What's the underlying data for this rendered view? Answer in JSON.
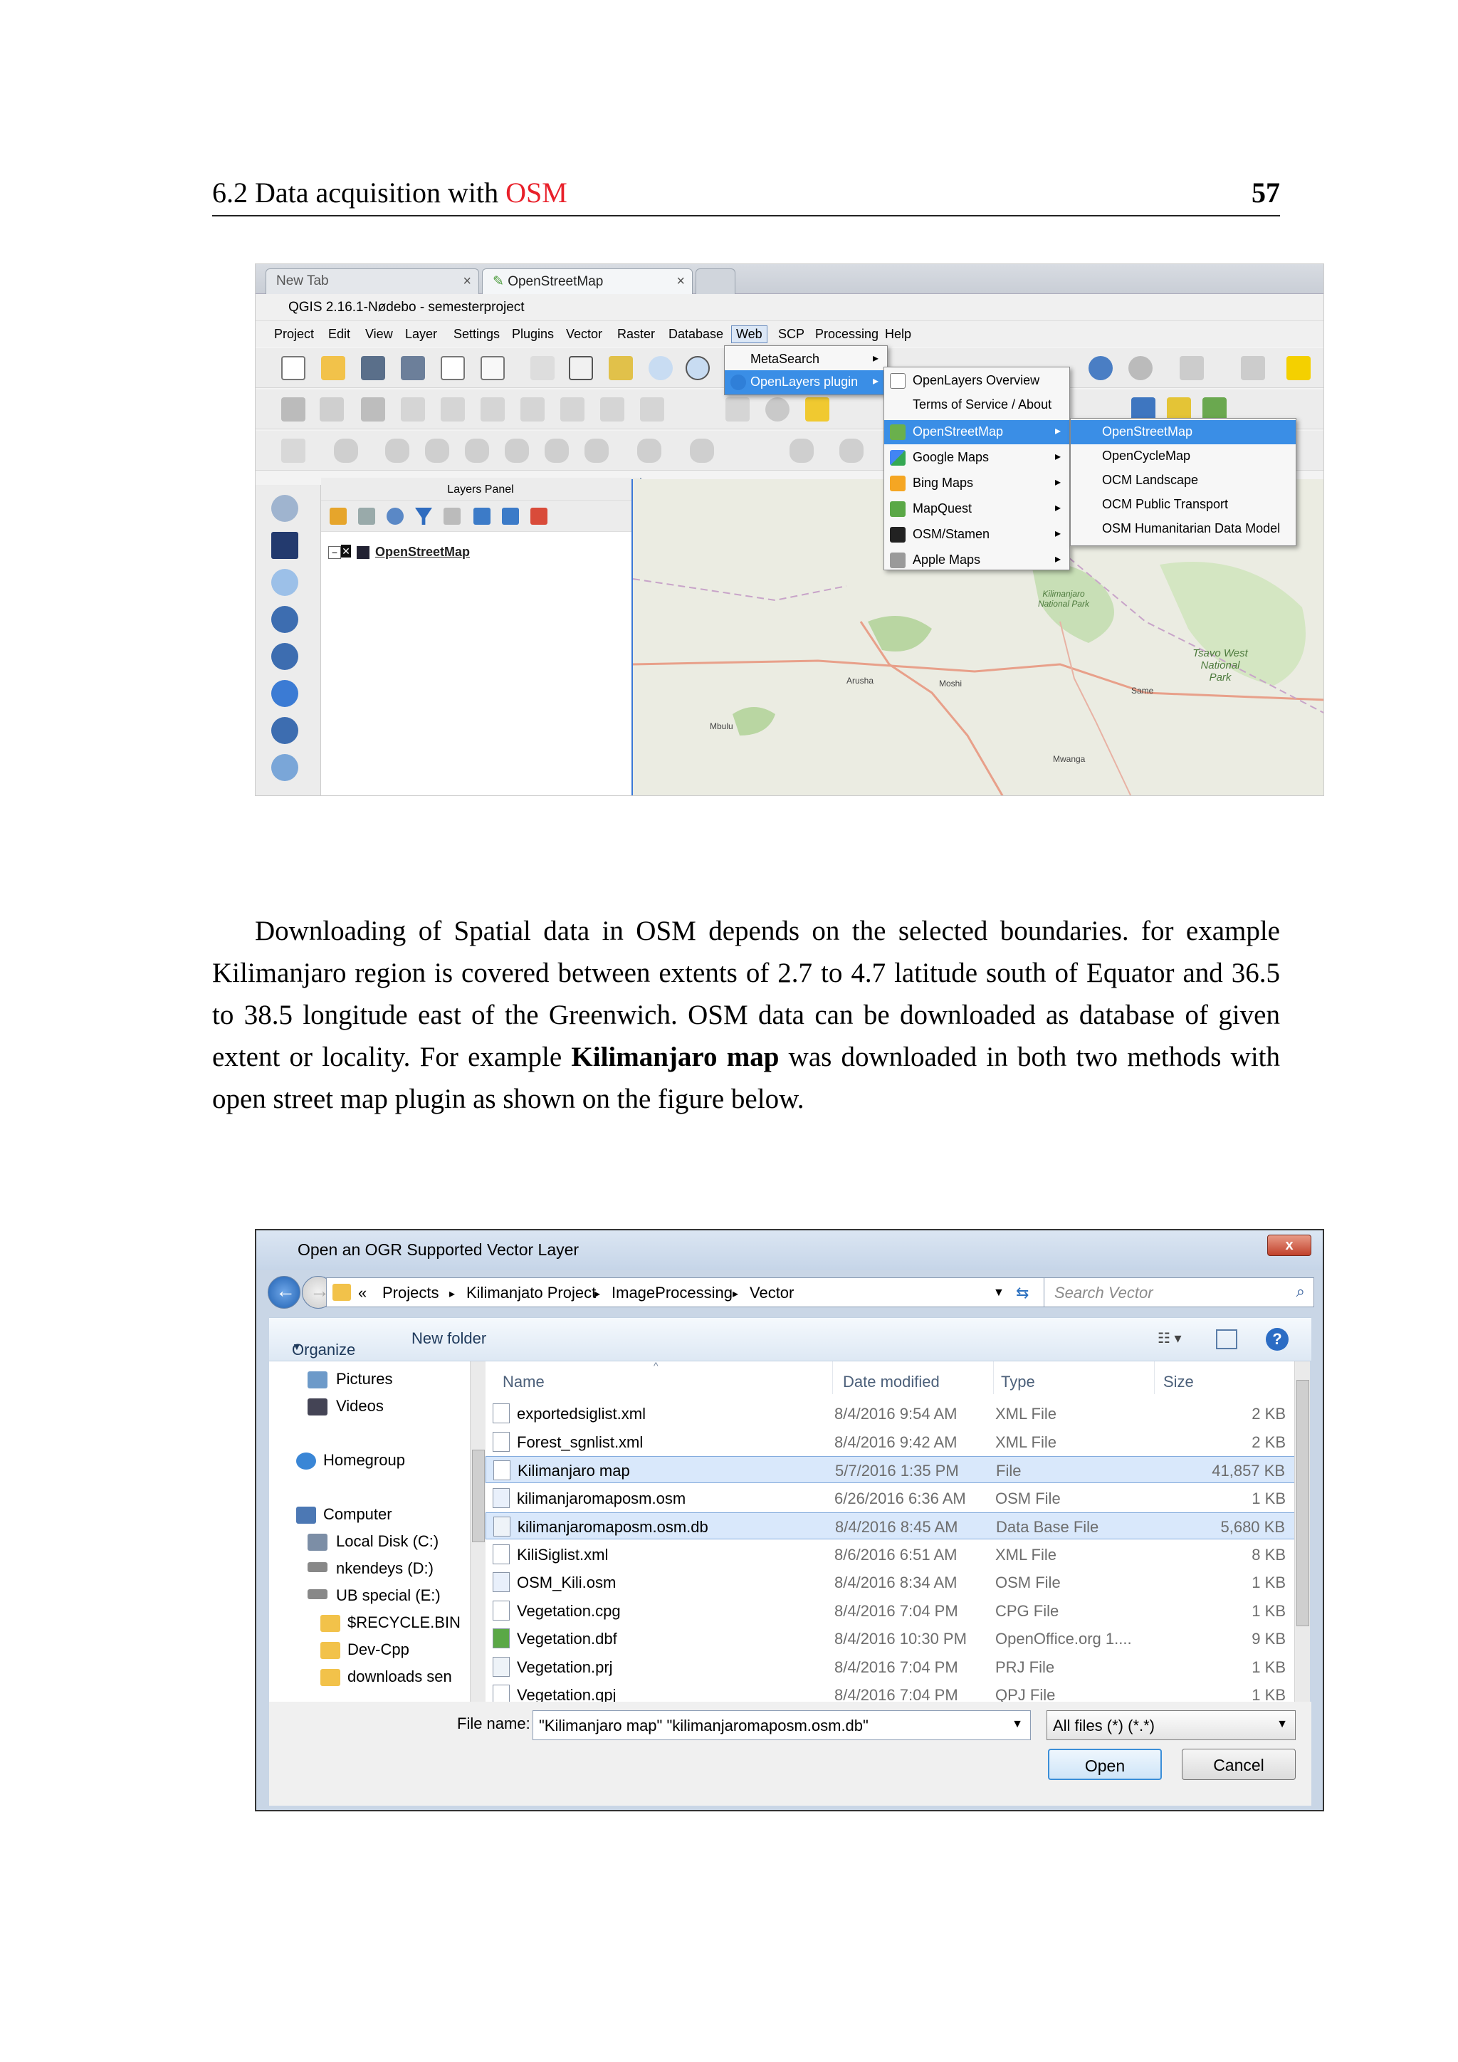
{
  "header": {
    "section_prefix": "6.2 Data acquisition with ",
    "section_highlight": "OSM",
    "page_number": "57"
  },
  "figure1": {
    "tabs": [
      {
        "label": "New Tab",
        "active": false
      },
      {
        "label": "OpenStreetMap",
        "active": true
      }
    ],
    "window_title": "QGIS 2.16.1-Nødebo - semesterproject",
    "menubar": [
      "Project",
      "Edit",
      "View",
      "Layer",
      "Settings",
      "Plugins",
      "Vector",
      "Raster",
      "Database",
      "Web",
      "SCP",
      "Processing",
      "Help"
    ],
    "selected_menu": "Web",
    "web_menu": [
      "MetaSearch",
      "OpenLayers plugin"
    ],
    "openlayers_menu": [
      "OpenLayers Overview",
      "Terms of Service / About",
      "OpenStreetMap",
      "Google Maps",
      "Bing Maps",
      "MapQuest",
      "OSM/Stamen",
      "Apple Maps"
    ],
    "osm_submenu": [
      "OpenStreetMap",
      "OpenCycleMap",
      "OCM Landscape",
      "OCM Public Transport",
      "OSM Humanitarian Data Model"
    ],
    "layers_panel_title": "Layers Panel",
    "layer_name": "OpenStreetMap",
    "map_labels": [
      "Tsavo West National Park",
      "Kilimanjaro National Park",
      "Arusha",
      "Moshi",
      "Mwanga",
      "Same",
      "Mbulu"
    ]
  },
  "paragraph": {
    "part1": "Downloading of Spatial data in OSM depends on the selected boundaries. for example Kilimanjaro region is covered between extents of 2.7 to 4.7 latitude south of Equator and 36.5 to 38.5 longitude east of the Greenwich.  OSM data can be downloaded as database of given extent or locality.  For example ",
    "bold": "Kilimanjaro map",
    "part2": " was downloaded in both two methods with open street map plugin as shown on the figure below."
  },
  "figure2": {
    "title": "Open an OGR Supported Vector Layer",
    "close_glyph": "x",
    "path": [
      "«",
      "Projects",
      "Kilimanjato Project",
      "ImageProcessing",
      "Vector"
    ],
    "search_placeholder": "Search Vector",
    "organize": "Organize",
    "new_folder": "New folder",
    "nav_items": [
      "Pictures",
      "Videos",
      "Homegroup",
      "Computer",
      "Local Disk (C:)",
      "nkendeys (D:)",
      "UB special (E:)",
      "$RECYCLE.BIN",
      "Dev-Cpp",
      "downloads sen"
    ],
    "columns": [
      "Name",
      "Date modified",
      "Type",
      "Size"
    ],
    "files": [
      {
        "name": "exportedsiglist.xml",
        "date": "8/4/2016 9:54 AM",
        "type": "XML File",
        "size": "2 KB"
      },
      {
        "name": "Forest_sgnlist.xml",
        "date": "8/4/2016 9:42 AM",
        "type": "XML File",
        "size": "2 KB"
      },
      {
        "name": "Kilimanjaro map",
        "date": "5/7/2016 1:35 PM",
        "type": "File",
        "size": "41,857 KB",
        "selected": true
      },
      {
        "name": "kilimanjaromaposm.osm",
        "date": "6/26/2016 6:36 AM",
        "type": "OSM File",
        "size": "1 KB"
      },
      {
        "name": "kilimanjaromaposm.osm.db",
        "date": "8/4/2016 8:45 AM",
        "type": "Data Base File",
        "size": "5,680 KB",
        "selected": true
      },
      {
        "name": "KiliSiglist.xml",
        "date": "8/6/2016 6:51 AM",
        "type": "XML File",
        "size": "8 KB"
      },
      {
        "name": "OSM_Kili.osm",
        "date": "8/4/2016 8:34 AM",
        "type": "OSM File",
        "size": "1 KB"
      },
      {
        "name": "Vegetation.cpg",
        "date": "8/4/2016 7:04 PM",
        "type": "CPG File",
        "size": "1 KB"
      },
      {
        "name": "Vegetation.dbf",
        "date": "8/4/2016 10:30 PM",
        "type": "OpenOffice.org 1....",
        "size": "9 KB"
      },
      {
        "name": "Vegetation.prj",
        "date": "8/4/2016 7:04 PM",
        "type": "PRJ File",
        "size": "1 KB"
      },
      {
        "name": "Vegetation.qpj",
        "date": "8/4/2016 7:04 PM",
        "type": "QPJ File",
        "size": "1 KB"
      }
    ],
    "filename_label": "File name:",
    "filename_value": "\"Kilimanjaro map\" \"kilimanjaromaposm.osm.db\"",
    "filter": "All files (*) (*.*)",
    "open": "Open",
    "cancel": "Cancel"
  }
}
